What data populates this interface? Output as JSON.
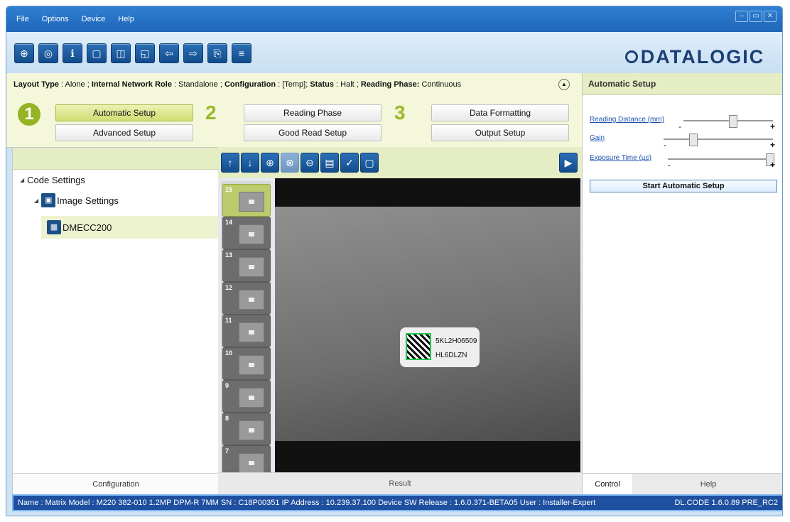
{
  "menu": [
    "File",
    "Options",
    "Device",
    "Help"
  ],
  "window_controls": [
    "minimize",
    "restore",
    "close"
  ],
  "toolbar": {
    "buttons": [
      {
        "name": "getting-started-icon",
        "glyph": "⊕"
      },
      {
        "name": "open-device-icon",
        "glyph": "◎"
      },
      {
        "name": "device-info-icon",
        "glyph": "ℹ"
      },
      {
        "name": "window-icon",
        "glyph": "▢"
      },
      {
        "name": "send-config-icon",
        "glyph": "◫"
      },
      {
        "name": "save-config-icon",
        "glyph": "◱"
      },
      {
        "name": "load-config-icon",
        "glyph": "⇦"
      },
      {
        "name": "export-icon",
        "glyph": "⇨"
      },
      {
        "name": "copy-config-icon",
        "glyph": "⎘"
      },
      {
        "name": "settings-table-icon",
        "glyph": "≡"
      }
    ],
    "logo": "DATALOGIC"
  },
  "info": {
    "layout_type_label": "Layout Type",
    "layout_type_value": " : Alone ; ",
    "network_role_label": "Internal Network Role",
    "network_role_value": " : Standalone ; ",
    "configuration_label": "Configuration",
    "configuration_value": " : [Temp]; ",
    "status_label": "Status",
    "status_value": " : Halt ; ",
    "reading_phase_label": "Reading Phase:",
    "reading_phase_value": " Continuous"
  },
  "steps": {
    "step1": "1",
    "step2": "2",
    "step3": "3",
    "automatic_setup": "Automatic Setup",
    "advanced_setup": "Advanced Setup",
    "reading_phase": "Reading Phase",
    "good_read_setup": "Good Read Setup",
    "data_formatting": "Data Formatting",
    "output_setup": "Output Setup"
  },
  "tree": {
    "root": "Code Settings",
    "image_settings": "Image Settings",
    "dmecc": "DMECC200"
  },
  "left_footer": "Configuration",
  "center_footer": "Result",
  "thumbnails": [
    "15",
    "14",
    "13",
    "12",
    "11",
    "10",
    "9",
    "8",
    "7"
  ],
  "image_label": {
    "line1": "5KL2H06509",
    "line2": "HL6DLZN"
  },
  "right_panel": {
    "title": "Automatic Setup",
    "sliders": [
      {
        "label": "Reading Distance (mm)",
        "value": 0.55
      },
      {
        "label": "Gain",
        "value": 0.25
      },
      {
        "label": "Exposure Time (µs)",
        "value": 1.0
      }
    ],
    "min_symbol": "-",
    "max_symbol": "+",
    "start_button": "Start Automatic Setup",
    "tab_control": "Control",
    "tab_help": "Help"
  },
  "statusbar": {
    "left": "Name : Matrix  Model : M220 382-010 1.2MP DPM-R 7MM   SN : C18P00351   IP Address :  10.239.37.100   Device SW Release : 1.6.0.371-BETA05   User : Installer-Expert",
    "right": "DL.CODE 1.6.0.89 PRE_RC2"
  }
}
